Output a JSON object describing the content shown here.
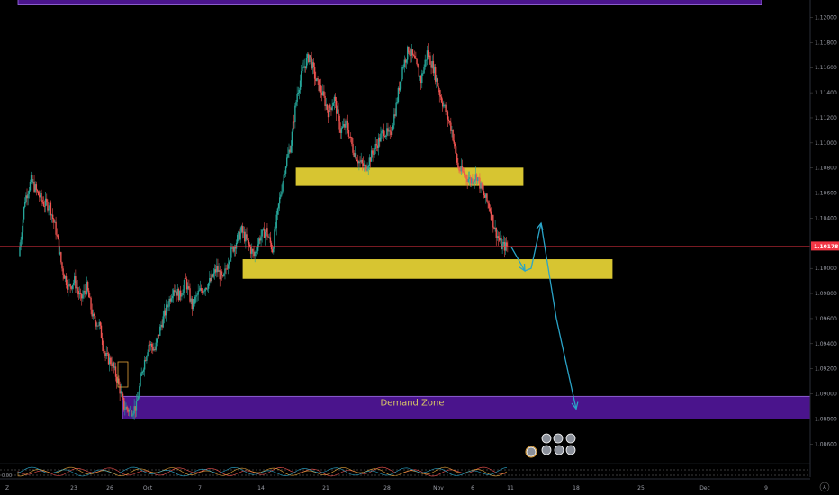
{
  "chart_data": {
    "type": "candlestick",
    "price_axis": {
      "ticks": [
        "1.12000",
        "1.11800",
        "1.11600",
        "1.11400",
        "1.11200",
        "1.11000",
        "1.10800",
        "1.10600",
        "1.10400",
        "1.10000",
        "1.09800",
        "1.09600",
        "1.09400",
        "1.09200",
        "1.09000",
        "1.08800",
        "1.08600"
      ],
      "range": [
        1.0848,
        1.1214
      ]
    },
    "time_axis": {
      "ticks": [
        "23",
        "26",
        "Oct",
        "7",
        "14",
        "21",
        "28",
        "Nov",
        "6",
        "11",
        "18",
        "25",
        "Dec",
        "9"
      ]
    },
    "last_price": {
      "label": "1.10178",
      "value": 1.10178,
      "color": "#f23645"
    },
    "colors": {
      "up": "#26a69a",
      "down": "#ef5350",
      "supply": "#d8c53a",
      "demand": "#5e1f9e",
      "arrow": "#2aa4c8"
    },
    "zones": [
      {
        "name": "supply-zone-upper",
        "low": 1.1066,
        "high": 1.108
      },
      {
        "name": "supply-zone-lower",
        "low": 1.0992,
        "high": 1.1007
      },
      {
        "name": "demand-zone",
        "label": "Demand Zone",
        "low": 1.088,
        "high": 1.0898
      },
      {
        "name": "top-zone",
        "low": 1.121,
        "high": 1.124
      }
    ],
    "projection_path": [
      {
        "date": "Nov 11",
        "price": 1.1017
      },
      {
        "date": "Nov 13",
        "price": 1.0998
      },
      {
        "date": "Nov 15",
        "price": 1.1
      },
      {
        "date": "Nov 16",
        "price": 1.1036
      },
      {
        "date": "Nov 18",
        "price": 1.096
      },
      {
        "date": "Nov 20",
        "price": 1.0888
      }
    ],
    "close_path": [
      1.101,
      1.1055,
      1.107,
      1.106,
      1.1052,
      1.105,
      1.103,
      1.1,
      1.0985,
      1.099,
      1.0975,
      1.0985,
      1.096,
      1.0955,
      1.093,
      1.0925,
      1.091,
      1.089,
      1.0886,
      1.089,
      1.092,
      1.094,
      1.0935,
      1.0955,
      1.097,
      1.0985,
      1.0978,
      1.099,
      1.097,
      1.098,
      1.0985,
      1.099,
      1.1,
      1.099,
      1.101,
      1.102,
      1.103,
      1.102,
      1.101,
      1.1025,
      1.103,
      1.1015,
      1.105,
      1.108,
      1.11,
      1.114,
      1.116,
      1.117,
      1.115,
      1.114,
      1.1125,
      1.1135,
      1.111,
      1.1115,
      1.1095,
      1.1085,
      1.108,
      1.109,
      1.11,
      1.111,
      1.1105,
      1.113,
      1.116,
      1.1175,
      1.1165,
      1.115,
      1.1172,
      1.116,
      1.114,
      1.1125,
      1.111,
      1.108,
      1.1075,
      1.107,
      1.1074,
      1.106,
      1.105,
      1.103,
      1.1018,
      1.1017
    ]
  },
  "ui": {
    "axis_z_label": "Z",
    "auto_label": "A",
    "indicator_scale_label": "0.00"
  }
}
